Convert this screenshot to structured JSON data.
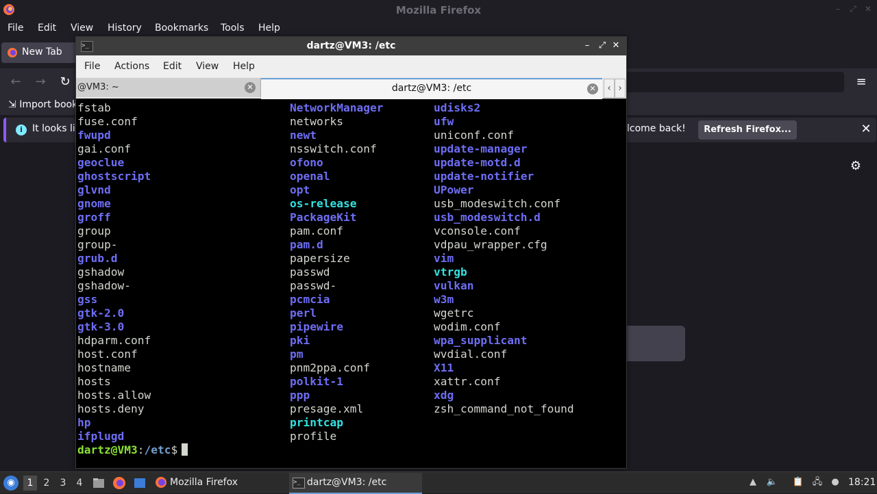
{
  "firefox": {
    "window_title": "Mozilla Firefox",
    "menu": [
      "File",
      "Edit",
      "View",
      "History",
      "Bookmarks",
      "Tools",
      "Help"
    ],
    "tab_label": "New Tab",
    "import_bookmarks": "Import book",
    "infobar_text": "It looks lik",
    "infobar_text_tail": "lcome back!",
    "refresh_button": "Refresh Firefox...",
    "close_glyph": "✕",
    "hamburger_glyph": "≡",
    "gear_glyph": "⚙",
    "back_glyph": "←",
    "forward_glyph": "→",
    "reload_glyph": "↻",
    "accent_color": "#9059ff"
  },
  "terminal": {
    "window_title": "dartz@VM3: /etc",
    "menu": [
      "File",
      "Actions",
      "Edit",
      "View",
      "Help"
    ],
    "tabs": [
      {
        "label": "@VM3: ~"
      },
      {
        "label": "dartz@VM3: /etc"
      }
    ],
    "tab_close_glyph": "✕",
    "arrow_left": "‹",
    "arrow_right": "›",
    "win_minimize": "–",
    "win_maximize": "⤢",
    "win_close": "✕",
    "listing_columns": [
      [
        {
          "name": "fstab",
          "type": "file"
        },
        {
          "name": "fuse.conf",
          "type": "file"
        },
        {
          "name": "fwupd",
          "type": "dir"
        },
        {
          "name": "gai.conf",
          "type": "file"
        },
        {
          "name": "geoclue",
          "type": "dir"
        },
        {
          "name": "ghostscript",
          "type": "dir"
        },
        {
          "name": "glvnd",
          "type": "dir"
        },
        {
          "name": "gnome",
          "type": "dir"
        },
        {
          "name": "groff",
          "type": "dir"
        },
        {
          "name": "group",
          "type": "file"
        },
        {
          "name": "group-",
          "type": "file"
        },
        {
          "name": "grub.d",
          "type": "dir"
        },
        {
          "name": "gshadow",
          "type": "file"
        },
        {
          "name": "gshadow-",
          "type": "file"
        },
        {
          "name": "gss",
          "type": "dir"
        },
        {
          "name": "gtk-2.0",
          "type": "dir"
        },
        {
          "name": "gtk-3.0",
          "type": "dir"
        },
        {
          "name": "hdparm.conf",
          "type": "file"
        },
        {
          "name": "host.conf",
          "type": "file"
        },
        {
          "name": "hostname",
          "type": "file"
        },
        {
          "name": "hosts",
          "type": "file"
        },
        {
          "name": "hosts.allow",
          "type": "file"
        },
        {
          "name": "hosts.deny",
          "type": "file"
        },
        {
          "name": "hp",
          "type": "dir"
        },
        {
          "name": "ifplugd",
          "type": "dir"
        }
      ],
      [
        {
          "name": "NetworkManager",
          "type": "dir"
        },
        {
          "name": "networks",
          "type": "file"
        },
        {
          "name": "newt",
          "type": "dir"
        },
        {
          "name": "nsswitch.conf",
          "type": "file"
        },
        {
          "name": "ofono",
          "type": "dir"
        },
        {
          "name": "openal",
          "type": "dir"
        },
        {
          "name": "opt",
          "type": "dir"
        },
        {
          "name": "os-release",
          "type": "link"
        },
        {
          "name": "PackageKit",
          "type": "dir"
        },
        {
          "name": "pam.conf",
          "type": "file"
        },
        {
          "name": "pam.d",
          "type": "dir"
        },
        {
          "name": "papersize",
          "type": "file"
        },
        {
          "name": "passwd",
          "type": "file"
        },
        {
          "name": "passwd-",
          "type": "file"
        },
        {
          "name": "pcmcia",
          "type": "dir"
        },
        {
          "name": "perl",
          "type": "dir"
        },
        {
          "name": "pipewire",
          "type": "dir"
        },
        {
          "name": "pki",
          "type": "dir"
        },
        {
          "name": "pm",
          "type": "dir"
        },
        {
          "name": "pnm2ppa.conf",
          "type": "file"
        },
        {
          "name": "polkit-1",
          "type": "dir"
        },
        {
          "name": "ppp",
          "type": "dir"
        },
        {
          "name": "presage.xml",
          "type": "file"
        },
        {
          "name": "printcap",
          "type": "link"
        },
        {
          "name": "profile",
          "type": "file"
        }
      ],
      [
        {
          "name": "udisks2",
          "type": "dir"
        },
        {
          "name": "ufw",
          "type": "dir"
        },
        {
          "name": "uniconf.conf",
          "type": "file"
        },
        {
          "name": "update-manager",
          "type": "dir"
        },
        {
          "name": "update-motd.d",
          "type": "dir"
        },
        {
          "name": "update-notifier",
          "type": "dir"
        },
        {
          "name": "UPower",
          "type": "dir"
        },
        {
          "name": "usb_modeswitch.conf",
          "type": "file"
        },
        {
          "name": "usb_modeswitch.d",
          "type": "dir"
        },
        {
          "name": "vconsole.conf",
          "type": "file"
        },
        {
          "name": "vdpau_wrapper.cfg",
          "type": "file"
        },
        {
          "name": "vim",
          "type": "dir"
        },
        {
          "name": "vtrgb",
          "type": "link"
        },
        {
          "name": "vulkan",
          "type": "dir"
        },
        {
          "name": "w3m",
          "type": "dir"
        },
        {
          "name": "wgetrc",
          "type": "file"
        },
        {
          "name": "wodim.conf",
          "type": "file"
        },
        {
          "name": "wpa_supplicant",
          "type": "dir"
        },
        {
          "name": "wvdial.conf",
          "type": "file"
        },
        {
          "name": "X11",
          "type": "dir"
        },
        {
          "name": "xattr.conf",
          "type": "file"
        },
        {
          "name": "xdg",
          "type": "dir"
        },
        {
          "name": "zsh_command_not_found",
          "type": "file"
        }
      ]
    ],
    "prompt": {
      "user_host": "dartz@VM3",
      "colon": ":",
      "path": "/etc",
      "dollar": "$"
    },
    "colors": {
      "file": "#d3d7cf",
      "dir": "#6e6ef5",
      "link": "#34e2e2",
      "prompt_user": "#8ae234",
      "prompt_path": "#729fcf"
    }
  },
  "taskbar": {
    "workspaces": [
      "1",
      "2",
      "3",
      "4"
    ],
    "active_workspace": "1",
    "tasks": [
      {
        "label": "Mozilla Firefox",
        "icon": "firefox-icon"
      },
      {
        "label": "dartz@VM3: /etc",
        "icon": "terminal-icon"
      }
    ],
    "clock": "18:21"
  }
}
